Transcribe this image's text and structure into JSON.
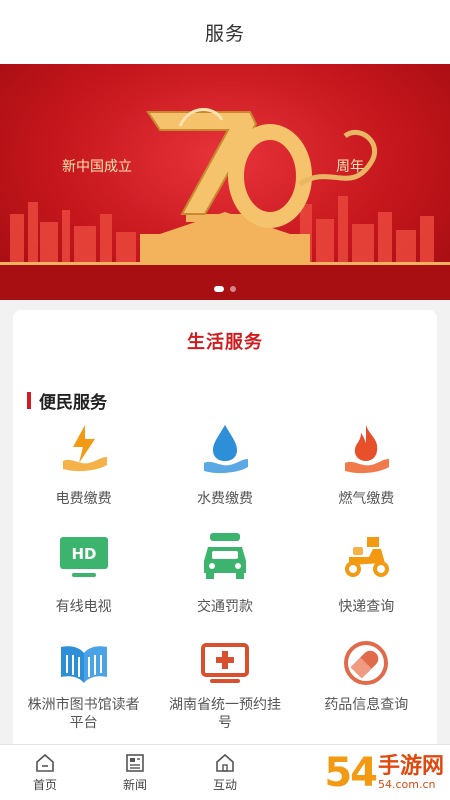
{
  "header": {
    "title": "服务"
  },
  "banner": {
    "left_text": "新中国成立",
    "big_number": "70",
    "right_text": "周年",
    "slide_count": 2,
    "active_slide": 1
  },
  "card": {
    "title": "生活服务",
    "section": "便民服务",
    "tiles": [
      {
        "label": "电费缴费",
        "icon": "electricity-icon"
      },
      {
        "label": "水费缴费",
        "icon": "water-drop-icon"
      },
      {
        "label": "燃气缴费",
        "icon": "flame-icon"
      },
      {
        "label": "有线电视",
        "icon": "tv-hd-icon"
      },
      {
        "label": "交通罚款",
        "icon": "car-icon"
      },
      {
        "label": "快递查询",
        "icon": "scooter-icon"
      },
      {
        "label": "株洲市图书馆读者平台",
        "icon": "book-icon"
      },
      {
        "label": "湖南省统一预约挂号",
        "icon": "hospital-icon"
      },
      {
        "label": "药品信息查询",
        "icon": "pill-icon"
      }
    ]
  },
  "tabbar": [
    {
      "label": "首页",
      "icon": "home-icon"
    },
    {
      "label": "新闻",
      "icon": "news-icon"
    },
    {
      "label": "互动",
      "icon": "interact-icon"
    }
  ],
  "watermark": {
    "number": "54",
    "name": "手游网",
    "url": "54.com.cn"
  },
  "colors": {
    "accent": "#d01c1f",
    "icon_orange": "#f39a12",
    "icon_blue": "#2d8fd8",
    "icon_green": "#3cb46e"
  }
}
